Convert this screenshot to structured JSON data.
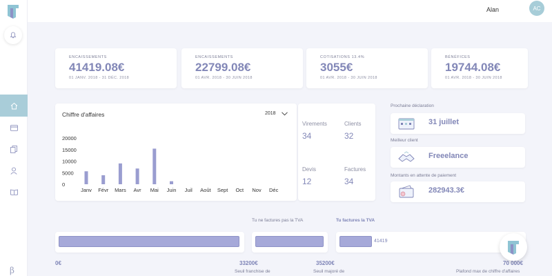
{
  "user": {
    "name": "Alan",
    "initials": "AC"
  },
  "sidebar": {
    "items": [
      {
        "icon": "home-icon"
      },
      {
        "icon": "card-icon"
      },
      {
        "icon": "documents-icon"
      },
      {
        "icon": "user-icon"
      },
      {
        "icon": "book-icon"
      }
    ],
    "beta": "β"
  },
  "kpis": [
    {
      "label": "ENCAISSEMENTS",
      "value": "41419.08€",
      "date": "01 JANV. 2018 - 31 DÉC. 2018"
    },
    {
      "label": "ENCAISSEMENTS",
      "value": "22799.08€",
      "date": "01 AVR. 2018 - 30 JUIN 2018"
    },
    {
      "label": "COTISATIONS 13.4%",
      "value": "3055€",
      "date": "01 AVR. 2018 - 30 JUIN 2018"
    },
    {
      "label": "BÉNÉFICES",
      "value": "19744.08€",
      "date": "01 AVR. 2018 - 30 JUIN 2018"
    }
  ],
  "chart": {
    "title": "Chiffre d'affaires",
    "year": "2018"
  },
  "chart_data": {
    "type": "bar",
    "categories": [
      "Janv",
      "Févr",
      "Mars",
      "Avr",
      "Mai",
      "Juin",
      "Juil",
      "Août",
      "Sept",
      "Oct",
      "Nov",
      "Déc"
    ],
    "values": [
      5600,
      3900,
      9000,
      6800,
      15400,
      1300,
      0,
      0,
      0,
      0,
      0,
      0
    ],
    "y_ticks": [
      "20000",
      "15000",
      "10000",
      "5000",
      "0"
    ],
    "ylim": [
      0,
      20000
    ],
    "color": "#9a9dd0",
    "grid": false
  },
  "stats": {
    "virements": {
      "label": "Virements",
      "value": "34"
    },
    "clients": {
      "label": "Clients",
      "value": "32"
    },
    "devis": {
      "label": "Devis",
      "value": "12"
    },
    "factures": {
      "label": "Factures",
      "value": "34"
    }
  },
  "side": {
    "declaration": {
      "label": "Prochaine déclaration",
      "value": "31 juillet"
    },
    "client": {
      "label": "Meilleur client",
      "value": "Freeelance"
    },
    "attente": {
      "label": "Montants en attente de paiement",
      "value": "282943.3€"
    }
  },
  "threshold": {
    "no_tva_label": "Tu ne factures pas la TVA",
    "tva_label": "Tu factures la TVA",
    "current_value": "41419",
    "start": "0€",
    "seuil_franchise": {
      "value": "33200€",
      "label": "Seuil franchise de"
    },
    "seuil_majore": {
      "value": "35200€",
      "label": "Seuil majoré de"
    },
    "plafond": {
      "value": "70 000€",
      "label": "Plafond max de chiffre d'affaires"
    }
  },
  "colors": {
    "accent": "#8287b7",
    "sidebar_active": "#a9cdd9",
    "bar": "#a6a9d9"
  }
}
